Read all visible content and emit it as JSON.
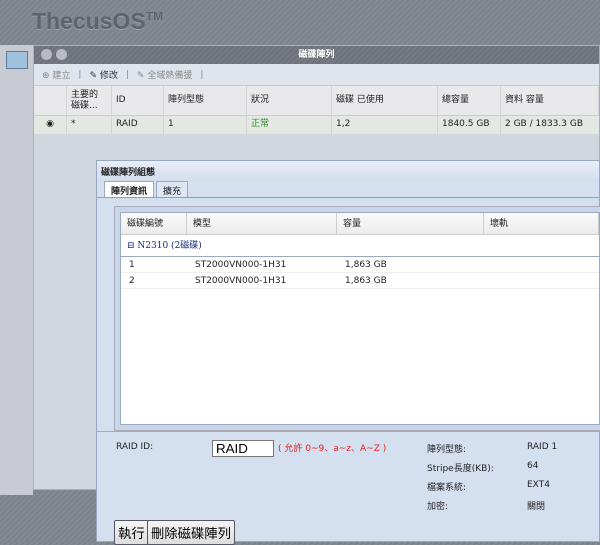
{
  "logo": "ThecusOS",
  "logo_tm": "TM",
  "window": {
    "title": "磁碟陣列",
    "toolbar": {
      "create": "建立",
      "modify": "修改",
      "hotspare": "全域熱備援"
    },
    "columns": [
      "主要的 磁碟...",
      "ID",
      "陣列型態",
      "狀況",
      "磁碟 已使用",
      "總容量",
      "資料 容量"
    ],
    "rows": [
      {
        "primary": "*",
        "id": "RAID",
        "level": "1",
        "status": "正常",
        "disks": "1,2",
        "total": "1840.5 GB",
        "data": "2 GB / 1833.3 GB"
      }
    ],
    "status_color": "#2e8b2e"
  },
  "dialog": {
    "title": "磁碟陣列組態",
    "tabs": [
      "陣列資訊",
      "擴充"
    ],
    "columns": [
      "磁碟編號",
      "模型",
      "容量",
      "壞軌"
    ],
    "group": "N2310 (2磁碟)",
    "disks": [
      {
        "no": "1",
        "model": "ST2000VN000-1H31",
        "cap": "1,863 GB"
      },
      {
        "no": "2",
        "model": "ST2000VN000-1H31",
        "cap": "1,863 GB"
      }
    ],
    "form": {
      "raid_id_label": "RAID ID:",
      "raid_id_value": "RAID",
      "hint": "( 允許 0~9、a~z、A~Z )",
      "level_label": "陣列型態:",
      "level": "RAID 1",
      "stripe_label": "Stripe長度(KB):",
      "stripe": "64",
      "fs_label": "檔案系統:",
      "fs": "EXT4",
      "enc_label": "加密:",
      "enc": "關閉",
      "apply": "執行",
      "remove": "刪除磁碟陣列"
    }
  }
}
